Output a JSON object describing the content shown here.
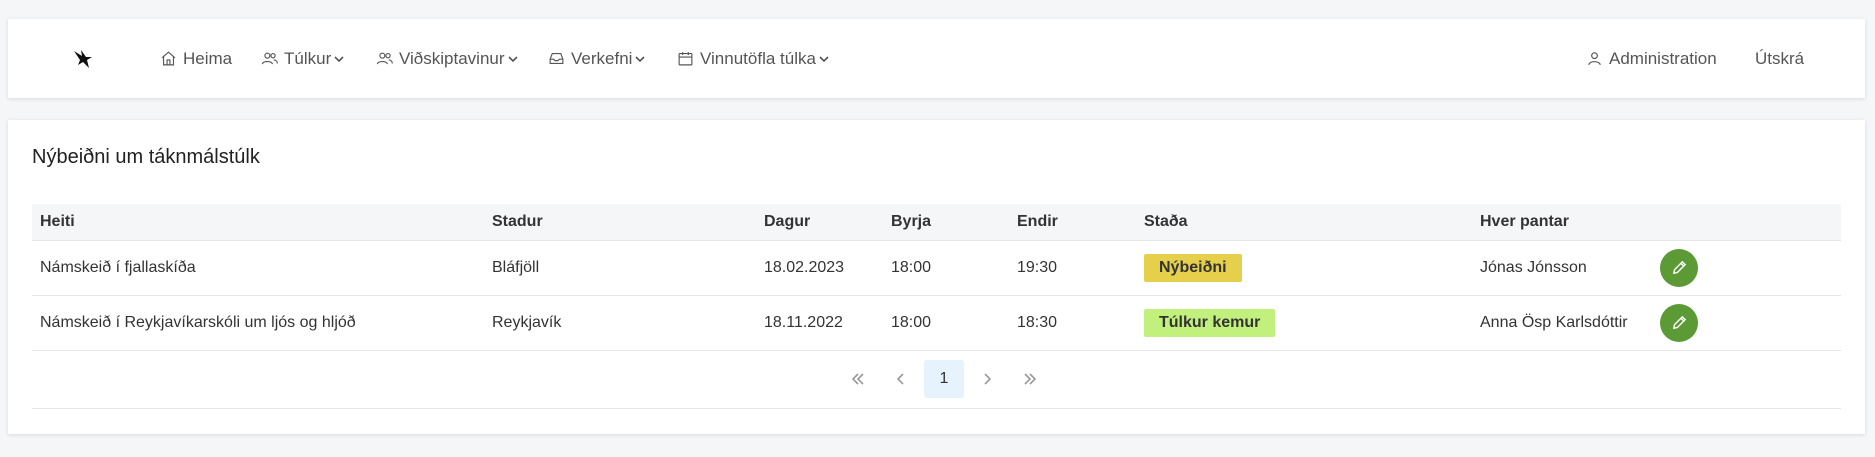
{
  "nav": {
    "home": "Heima",
    "interpreters": "Túlkur",
    "customer": "Viðskiptavinur",
    "projects": "Verkefni",
    "workflow": "Vinnutöfla túlka",
    "admin": "Administration",
    "logout": "Útskrá"
  },
  "main": {
    "title": "Nýbeiðni um táknmálstúlk",
    "columns": [
      "Heiti",
      "Stadur",
      "Dagur",
      "Byrja",
      "Endir",
      "Staða",
      "Hver pantar"
    ],
    "rows": [
      {
        "heiti": "Námskeið í fjallaskíða",
        "stadur": "Bláfjöll",
        "dagur": "18.02.2023",
        "byrja": "18:00",
        "endir": "19:30",
        "stada": "Nýbeiðni",
        "stada_color": "#e6cf4a",
        "hver": "Jónas Jónsson"
      },
      {
        "heiti": "Námskeið í Reykjavíkarskóli um ljós og hljóð",
        "stadur": "Reykjavík",
        "dagur": "18.11.2022",
        "byrja": "18:00",
        "endir": "18:30",
        "stada": "Túlkur kemur",
        "stada_color": "#c2f07c",
        "hver": "Anna Ösp Karlsdóttir"
      }
    ]
  },
  "pagination": {
    "current": "1"
  },
  "colors": {
    "edit_button": "#5b9a35",
    "active_page_bg": "#e6f2fc"
  }
}
